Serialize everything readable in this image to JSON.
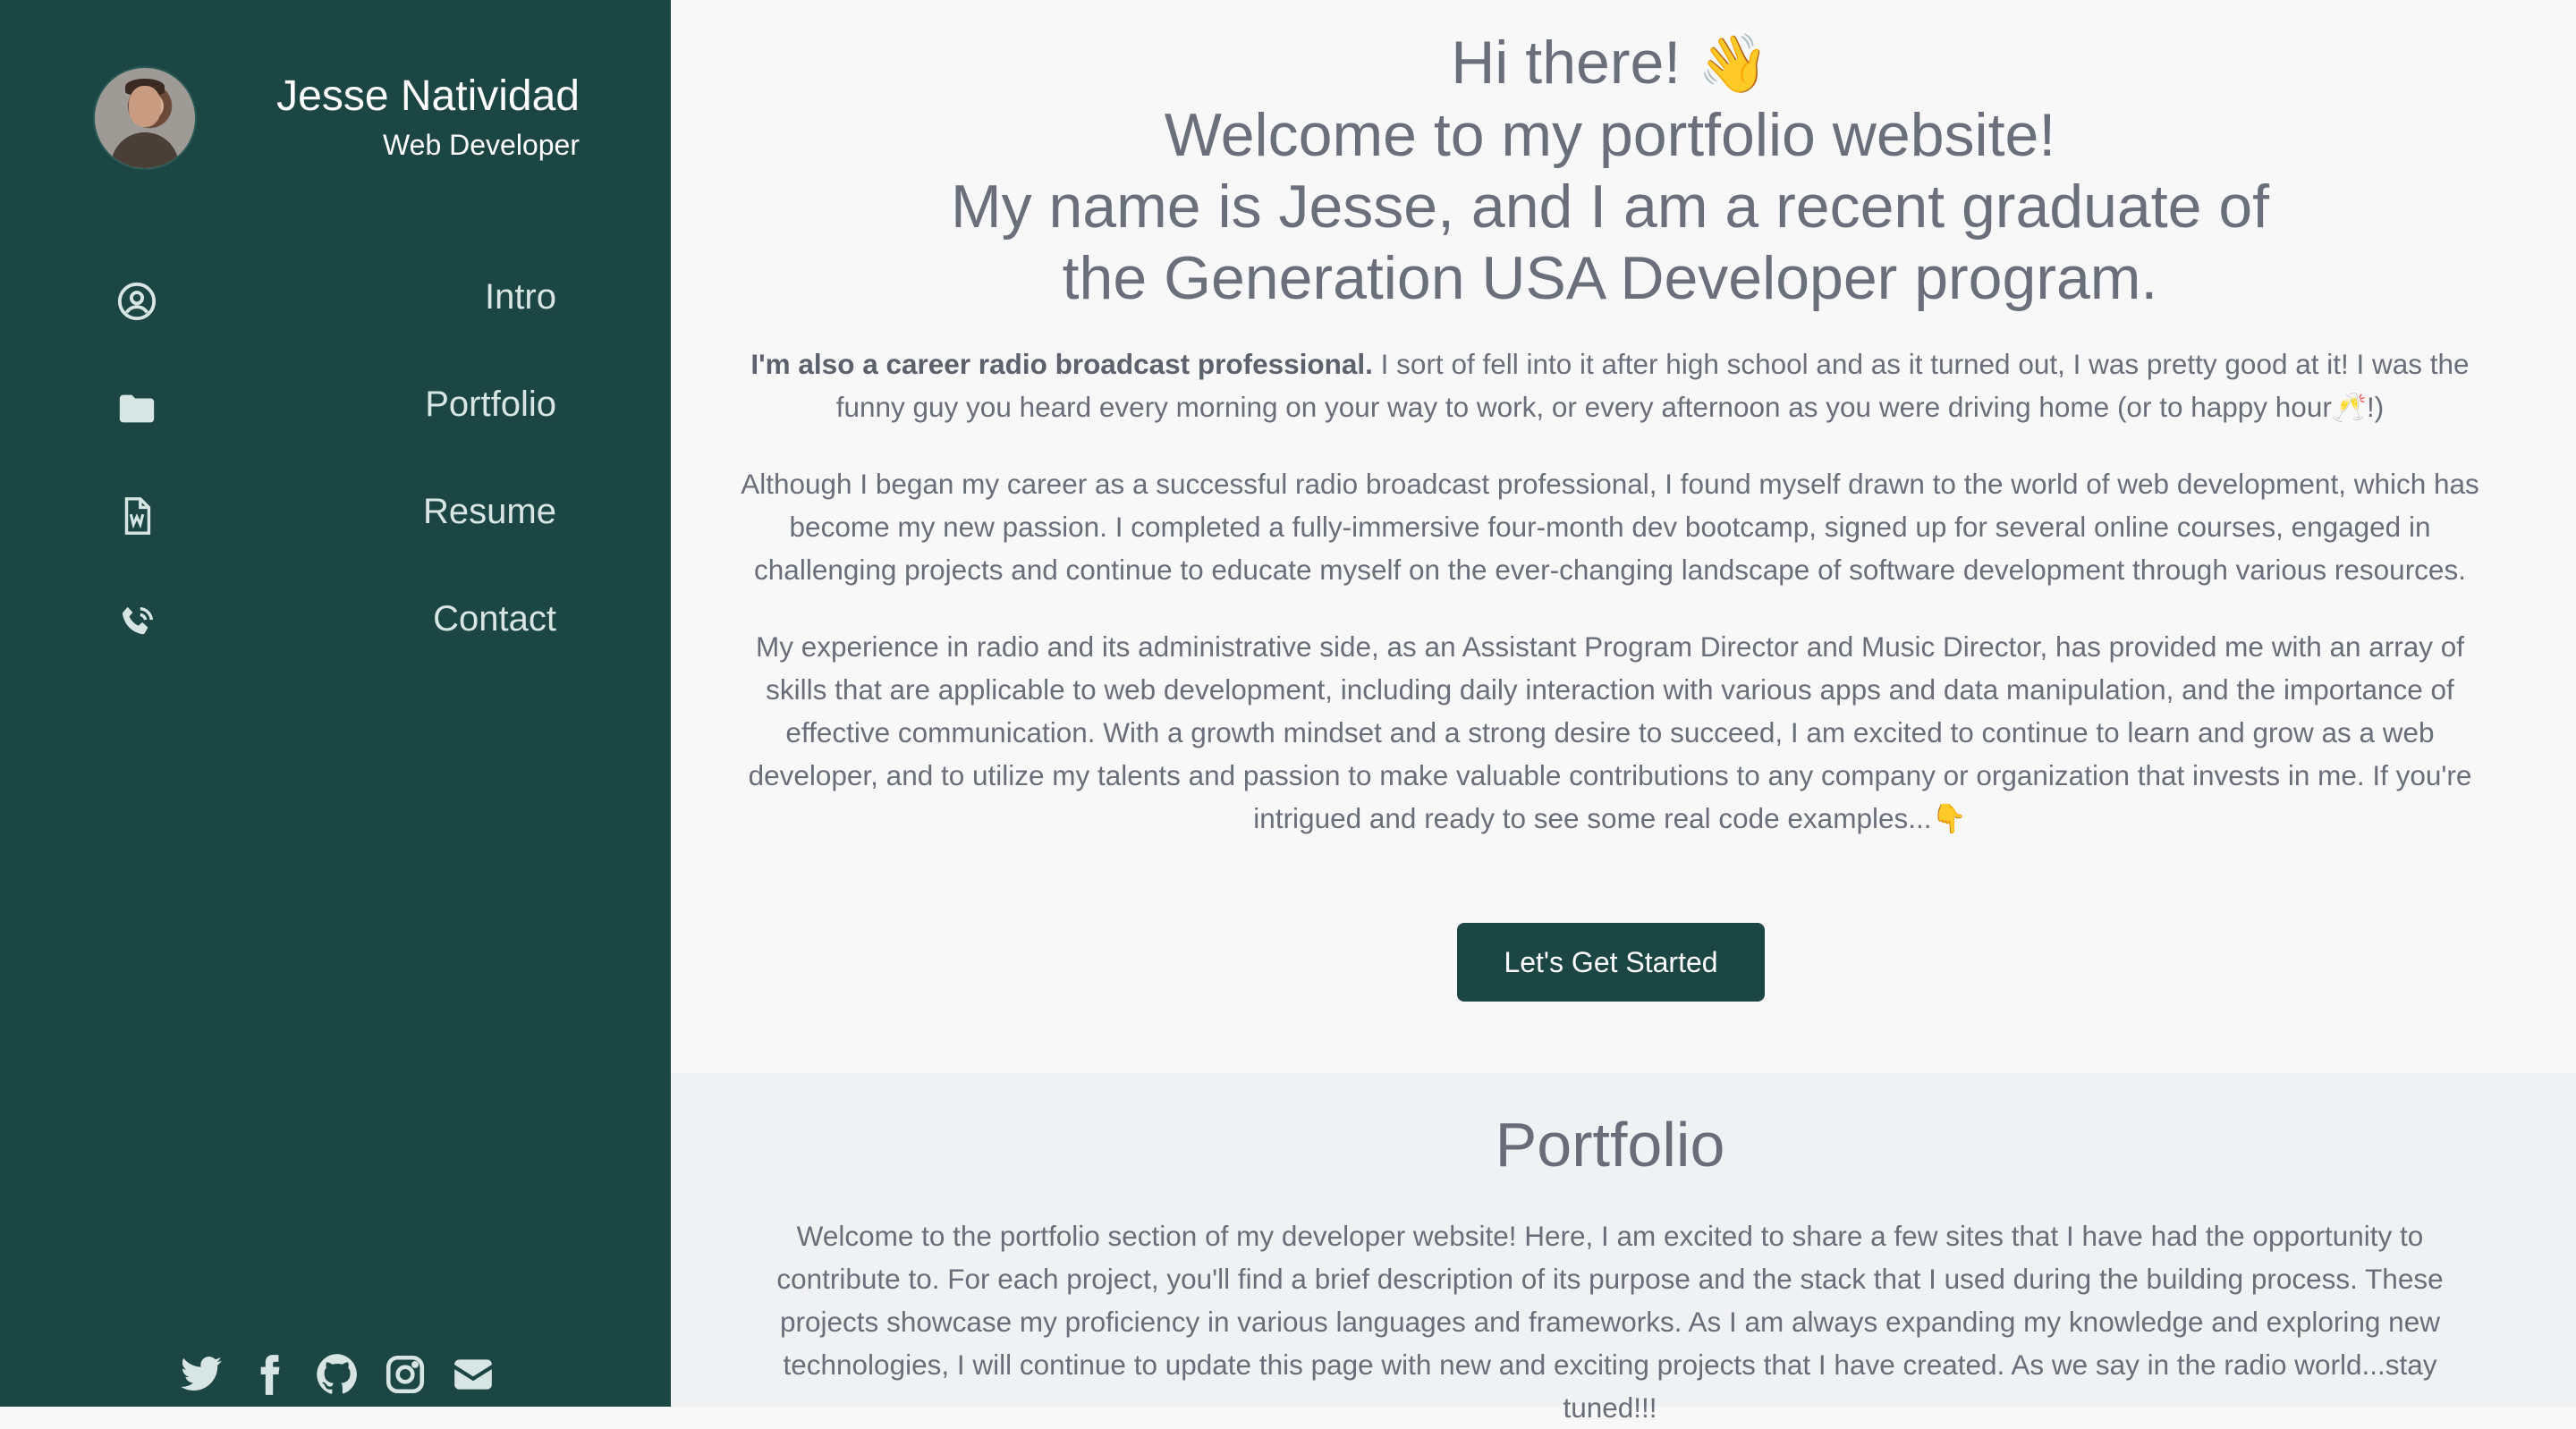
{
  "sidebar": {
    "name": "Jesse Natividad",
    "role": "Web Developer",
    "nav": [
      {
        "label": "Intro",
        "icon": "user-circle-icon"
      },
      {
        "label": "Portfolio",
        "icon": "folder-icon"
      },
      {
        "label": "Resume",
        "icon": "word-document-icon"
      },
      {
        "label": "Contact",
        "icon": "phone-icon"
      }
    ],
    "social": [
      "twitter-icon",
      "facebook-icon",
      "github-icon",
      "instagram-icon",
      "envelope-icon"
    ]
  },
  "intro": {
    "title_line1": "Hi there!",
    "wave_emoji": "👋",
    "title_line2": "Welcome to my portfolio website!",
    "title_line3": "My name is Jesse, and I am a recent graduate of",
    "title_line4": "the Generation USA Developer program.",
    "p1_bold": "I'm also a career radio broadcast professional.",
    "p1_text": " I sort of fell into it after high school and as it turned out, I was pretty good at it! I was the funny guy you heard every morning on your way to work, or every afternoon as you were driving home (or to happy hour🥂!)",
    "p2": "Although I began my career as a successful radio broadcast professional, I found myself drawn to the world of web development, which has become my new passion. I completed a fully-immersive four-month dev bootcamp, signed up for several online courses, engaged in challenging projects and continue to educate myself on the ever-changing landscape of software development through various resources.",
    "p3": "My experience in radio and its administrative side, as an Assistant Program Director and Music Director, has provided me with an array of skills that are applicable to web development, including daily interaction with various apps and data manipulation, and the importance of effective communication. With a growth mindset and a strong desire to succeed, I am excited to continue to learn and grow as a web developer, and to utilize my talents and passion to make valuable contributions to any company or organization that invests in me. If you're intrigued and ready to see some real code examples...👇",
    "cta": "Let's Get Started"
  },
  "portfolio": {
    "title": "Portfolio",
    "text": "Welcome to the portfolio section of my developer website! Here, I am excited to share a few sites that I have had the opportunity to contribute to. For each project, you'll find a brief description of its purpose and the stack that I used during the building process. These projects showcase my proficiency in various languages and frameworks. As I am always expanding my knowledge and exploring new technologies, I will continue to update this page with new and exciting projects that I have created. As we say in the radio world...stay tuned!!!"
  },
  "colors": {
    "sidebar_bg": "#1c4643",
    "button_bg": "#1c4643",
    "text_gray": "#6b6f7c"
  }
}
